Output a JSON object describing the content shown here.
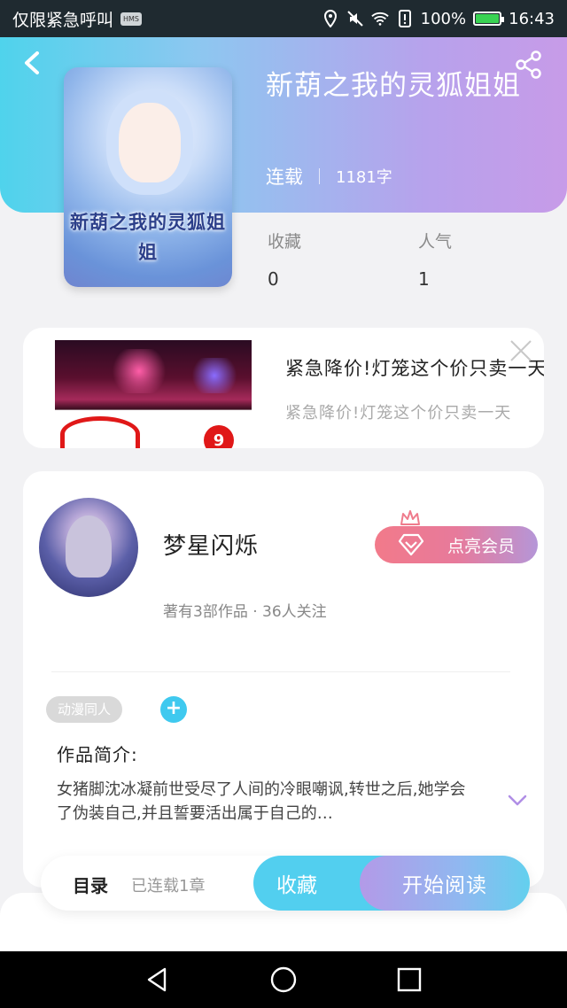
{
  "status_bar": {
    "carrier": "仅限紧急呼叫",
    "hms_badge": "HMS",
    "battery": "100%",
    "time": "16:43"
  },
  "book": {
    "title": "新葫之我的灵狐姐姐",
    "cover_text": "新葫之我的灵狐姐姐",
    "status": "连载",
    "word_count": "1181字",
    "stats": [
      {
        "label": "收藏",
        "value": "0"
      },
      {
        "label": "人气",
        "value": "1"
      }
    ]
  },
  "ad": {
    "title": "紧急降价!灯笼这个价只卖一天",
    "subtitle": "紧急降价!灯笼这个价只卖一天",
    "badge": "9"
  },
  "author": {
    "name": "梦星闪烁",
    "info": "著有3部作品 · 36人关注",
    "vip_label": "点亮会员"
  },
  "tags": [
    "动漫同人"
  ],
  "synopsis": {
    "label": "作品简介:",
    "text": "女猪脚沈冰凝前世受尽了人间的冷眼嘲讽,转世之后,她学会了伪装自己,并且誓要活出属于自己的…"
  },
  "action_bar": {
    "toc_label": "目录",
    "toc_count": "已连载1章",
    "favorite_label": "收藏",
    "read_label": "开始阅读"
  },
  "colors": {
    "header_start": "#4fd3ec",
    "header_end": "#c79be8",
    "accent_blue": "#52cfef",
    "vip_pink": "#f27a8a"
  }
}
